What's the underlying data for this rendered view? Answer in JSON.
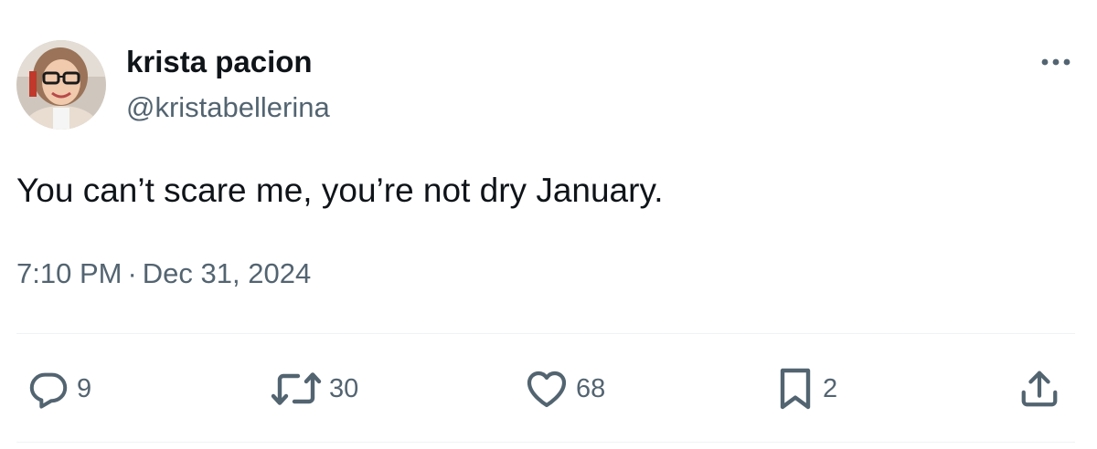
{
  "author": {
    "name": "krista pacion",
    "handle": "@kristabellerina"
  },
  "tweet": {
    "text": "You can’t scare me, you’re not dry January.",
    "time": "7:10 PM",
    "separator": "·",
    "date": "Dec 31, 2024"
  },
  "actions": {
    "replies": "9",
    "retweets": "30",
    "likes": "68",
    "bookmarks": "2"
  },
  "colors": {
    "text": "#0f1419",
    "secondary": "#536471",
    "divider": "#eff3f4"
  },
  "icons": [
    "more-icon",
    "reply-icon",
    "retweet-icon",
    "like-icon",
    "bookmark-icon",
    "share-icon"
  ]
}
